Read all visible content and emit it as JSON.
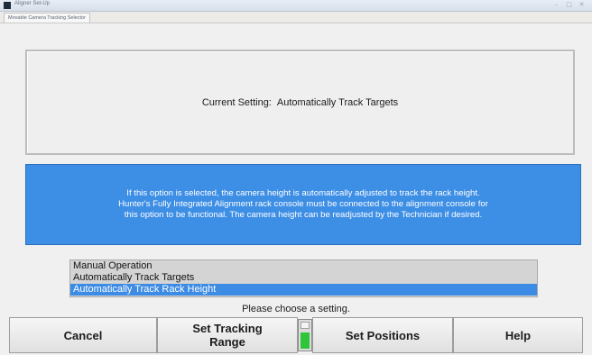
{
  "window": {
    "title": "Aligner Set-Up",
    "tab_label": "Movable Camera Tracking Selector",
    "controls": [
      "–",
      "□",
      "✕"
    ]
  },
  "current_setting": {
    "label": "Current Setting:",
    "value": "Automatically Track Targets"
  },
  "info": {
    "lines": [
      "If this option is selected, the camera height is automatically adjusted to track the rack height.",
      "Hunter's Fully Integrated Alignment rack console must be connected to the alignment console for",
      "this option to be functional.  The camera height can be readjusted by the Technician if desired."
    ]
  },
  "options": {
    "items": [
      "Manual Operation",
      "Automatically Track Targets",
      "Automatically Track Rack Height"
    ],
    "selected": "Automatically Track Rack Height"
  },
  "prompt": "Please choose a setting.",
  "buttons": {
    "cancel": "Cancel",
    "set_tracking_range_line1": "Set Tracking",
    "set_tracking_range_line2": "Range",
    "set_positions": "Set Positions",
    "help": "Help"
  },
  "indicator": {
    "fill_fraction": 0.6,
    "color": "#2fc43a"
  },
  "colors": {
    "accent_blue": "#3d8ee5",
    "selection_blue": "#3c8be4"
  }
}
